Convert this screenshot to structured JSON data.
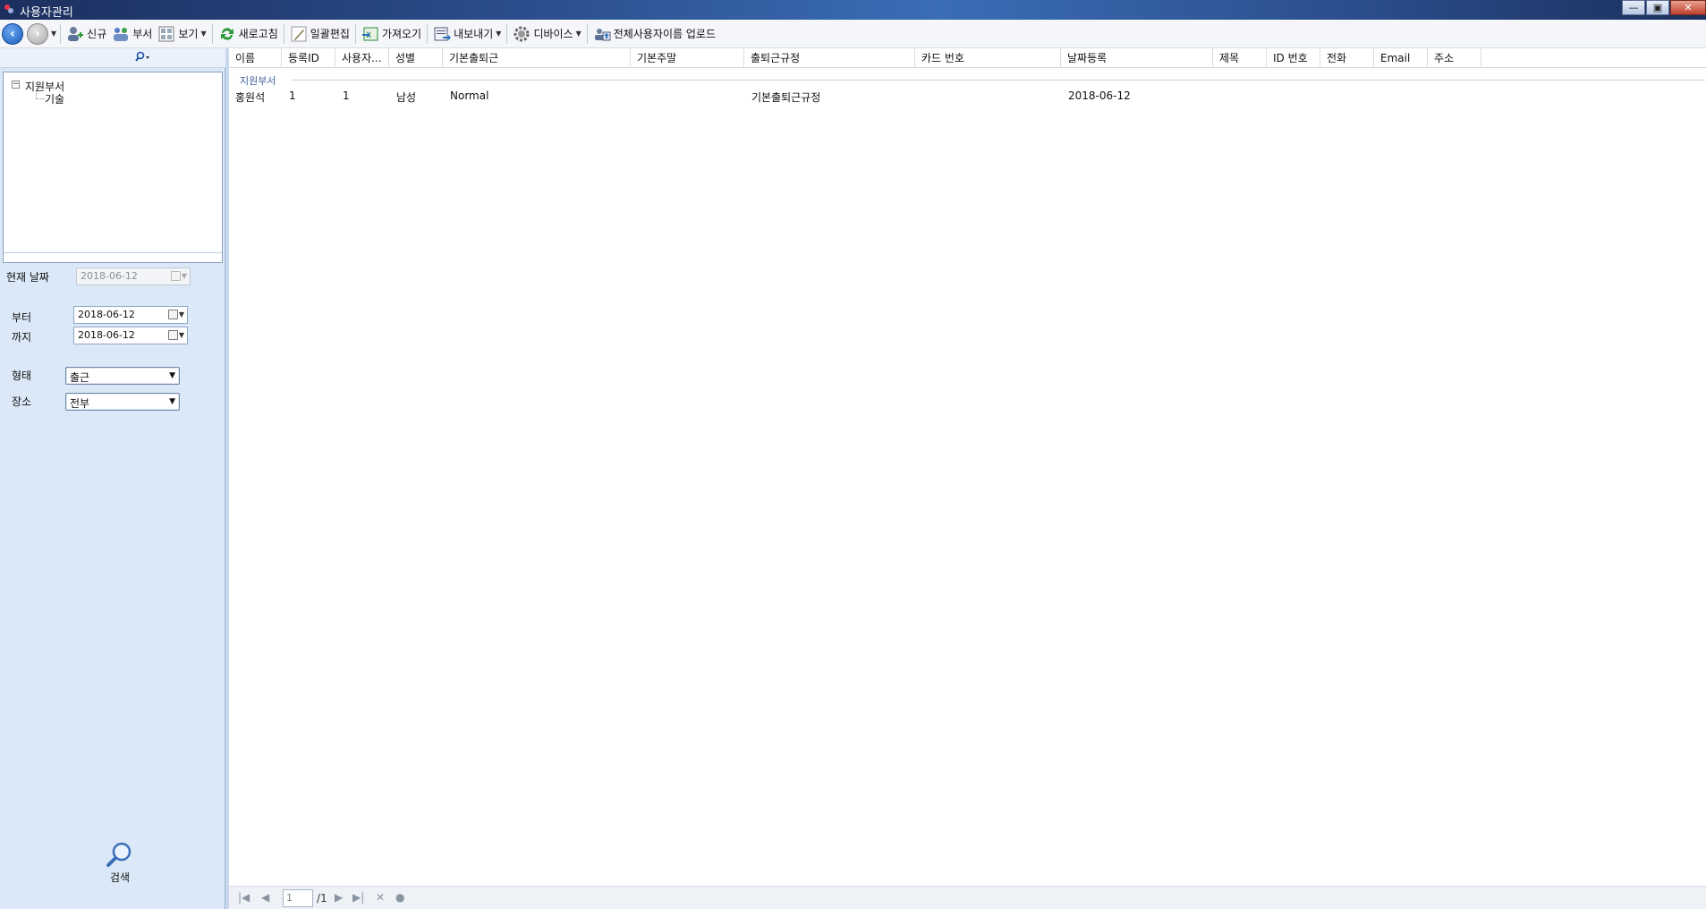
{
  "window": {
    "title": "사용자관리",
    "minimize_glyph": "—",
    "maximize_glyph": "▣",
    "close_glyph": "✕"
  },
  "toolbar": {
    "new_label": "신규",
    "department_label": "부서",
    "view_label": "보기",
    "refresh_label": "새로고침",
    "batch_edit_label": "일괄편집",
    "import_label": "가져오기",
    "export_label": "내보내기",
    "device_label": "디바이스",
    "upload_all_names_label": "전체사용자이름 업로드"
  },
  "tree": {
    "root": "지원부서",
    "children": [
      "기술"
    ]
  },
  "filters": {
    "current_date_label": "현재 날짜",
    "current_date_value": "2018-06-12",
    "from_label": "부터",
    "from_value": "2018-06-12",
    "to_label": "까지",
    "to_value": "2018-06-12",
    "type_label": "형태",
    "type_value": "출근",
    "place_label": "장소",
    "place_value": "전부",
    "search_label": "검색"
  },
  "grid": {
    "columns": [
      "이름",
      "등록ID",
      "사용자...",
      "성별",
      "기본출퇴근",
      "기본주말",
      "출퇴근규정",
      "카드 번호",
      "날짜등록",
      "제목",
      "ID 번호",
      "전화",
      "Email",
      "주소"
    ],
    "group": "지원부서",
    "rows": [
      {
        "name": "홍원석",
        "reg_id": "1",
        "user": "1",
        "gender": "남성",
        "basic_shift": "Normal",
        "weekend": "",
        "rule": "기본출퇴근규정",
        "card": "",
        "date": "2018-06-12",
        "title": "",
        "id_no": "",
        "phone": "",
        "email": "",
        "address": ""
      }
    ]
  },
  "pager": {
    "page": "1",
    "total": "/1"
  },
  "colors": {
    "accent": "#1c5bbd",
    "panel_bg": "#dbe8f7",
    "group_text": "#3f5e9c"
  }
}
